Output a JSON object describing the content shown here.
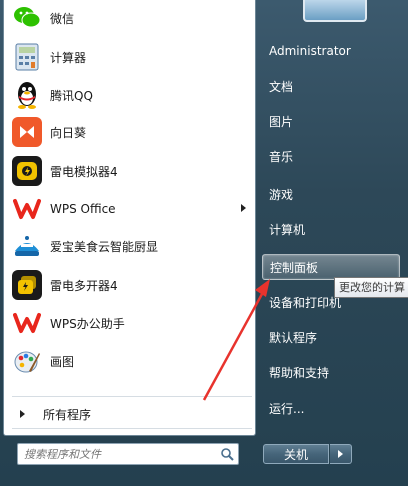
{
  "programs": [
    {
      "label": "微信",
      "icon": "wechat-icon",
      "color": "#2dc100"
    },
    {
      "label": "计算器",
      "icon": "calculator-icon",
      "color": "#5a7fa6"
    },
    {
      "label": "腾讯QQ",
      "icon": "qq-penguin-icon",
      "color": "#111111"
    },
    {
      "label": "向日葵",
      "icon": "sunflower-icon",
      "color": "#f0592a"
    },
    {
      "label": "雷电模拟器4",
      "icon": "leidian-emulator-icon",
      "color": "#f2c200"
    },
    {
      "label": "WPS Office",
      "icon": "wps-icon",
      "color": "#e8261c"
    },
    {
      "label": "爱宝美食云智能厨显",
      "icon": "aibao-icon",
      "color": "#1f8fd6"
    },
    {
      "label": "雷电多开器4",
      "icon": "leidian-multi-icon",
      "color": "#f2c200"
    },
    {
      "label": "WPS办公助手",
      "icon": "wps-assistant-icon",
      "color": "#e8261c"
    },
    {
      "label": "画图",
      "icon": "paint-icon",
      "color": "#6ba4d8"
    }
  ],
  "all_programs_label": "所有程序",
  "search": {
    "placeholder": "搜索程序和文件"
  },
  "right_panel": {
    "user": "Administrator",
    "items": [
      "文档",
      "图片",
      "音乐",
      "游戏",
      "计算机",
      "控制面板",
      "设备和打印机",
      "默认程序",
      "帮助和支持",
      "运行..."
    ]
  },
  "tooltip": "更改您的计算",
  "shutdown_label": "关机",
  "annotation_color": "#e8332d"
}
